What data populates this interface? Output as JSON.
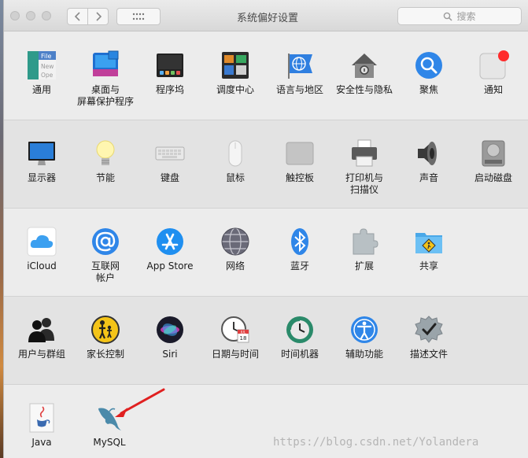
{
  "window": {
    "title": "系统偏好设置"
  },
  "search": {
    "placeholder": "搜索"
  },
  "rows": [
    [
      "通用",
      "桌面与\n屏幕保护程序",
      "程序坞",
      "调度中心",
      "语言与地区",
      "安全性与隐私",
      "聚焦",
      "通知"
    ],
    [
      "显示器",
      "节能",
      "键盘",
      "鼠标",
      "触控板",
      "打印机与\n扫描仪",
      "声音",
      "启动磁盘"
    ],
    [
      "iCloud",
      "互联网\n帐户",
      "App Store",
      "网络",
      "蓝牙",
      "扩展",
      "共享"
    ],
    [
      "用户与群组",
      "家长控制",
      "Siri",
      "日期与时间",
      "时间机器",
      "辅助功能",
      "描述文件"
    ],
    [
      "Java",
      "MySQL"
    ]
  ],
  "icons": {
    "general": {
      "lines": [
        "File",
        "New",
        "Ope"
      ]
    },
    "datetime": {
      "month": "JUL",
      "day": "18"
    }
  },
  "watermark": "https://blog.csdn.net/Yolandera",
  "colors": {
    "annotation_arrow": "#e02020",
    "notification_badge": "#ff2a2a"
  }
}
